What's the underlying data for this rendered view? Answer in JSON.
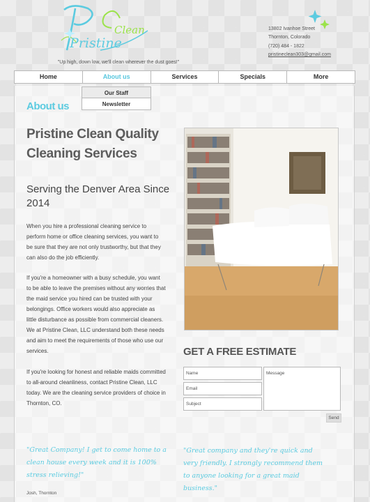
{
  "header": {
    "logo_text": [
      "Pristine",
      "Clean"
    ],
    "tagline": "\"Up high, down low, we'll clean wherever the dust goes!\"",
    "contact": {
      "street": "13802 Ivanhoe Street",
      "city": "Thornton, Colorado",
      "phone": "(720) 484 - 1822",
      "email": "pristineclean303@gmail.com"
    }
  },
  "nav": {
    "items": [
      "Home",
      "About us",
      "Services",
      "Specials",
      "More"
    ],
    "active": "About us",
    "submenu": [
      "Our Staff",
      "Newsletter"
    ]
  },
  "main": {
    "section_title": "About us",
    "headline": "Pristine Clean Quality Cleaning Services",
    "subheadline": "Serving the Denver Area Since 2014",
    "paragraphs": [
      "When you hire a professional cleaning service to perform home or office cleaning services, you want to be sure that they are not only trustworthy, but that they can also do the job efficiently.",
      "If you're a homeowner with a busy schedule, you want to be able to leave the premises without any worries that the maid service you hired can be trusted with your belongings. Office workers would also appreciate as little disturbance as possible from commercial cleaners. We at Pristine Clean, LLC understand both these needs and aim to meet the requirements of those who use our services.",
      "If you're looking for honest and reliable maids committed to all-around cleanliness, contact Pristine Clean, LLC today. We are the cleaning service providers of choice in Thornton, CO."
    ]
  },
  "estimate": {
    "heading": "GET A FREE ESTIMATE",
    "name_placeholder": "Name",
    "email_placeholder": "Email",
    "subject_placeholder": "Subject",
    "message_placeholder": "Message",
    "send_label": "Send"
  },
  "testimonials": [
    {
      "quote": "\"Great Company! I get to come home to a clean house every week and it is 100% stress relieving!\"",
      "author": "Josh, Thornton"
    },
    {
      "quote": "\"Great company and they're quick and very friendly. I strongly recommend them to anyone looking for a great maid business.\"",
      "author": ""
    }
  ],
  "colors": {
    "accent": "#5ccbe0",
    "logo_green": "#9be34a",
    "text": "#444444"
  },
  "icons": {
    "sparkle": "sparkle-icon"
  }
}
